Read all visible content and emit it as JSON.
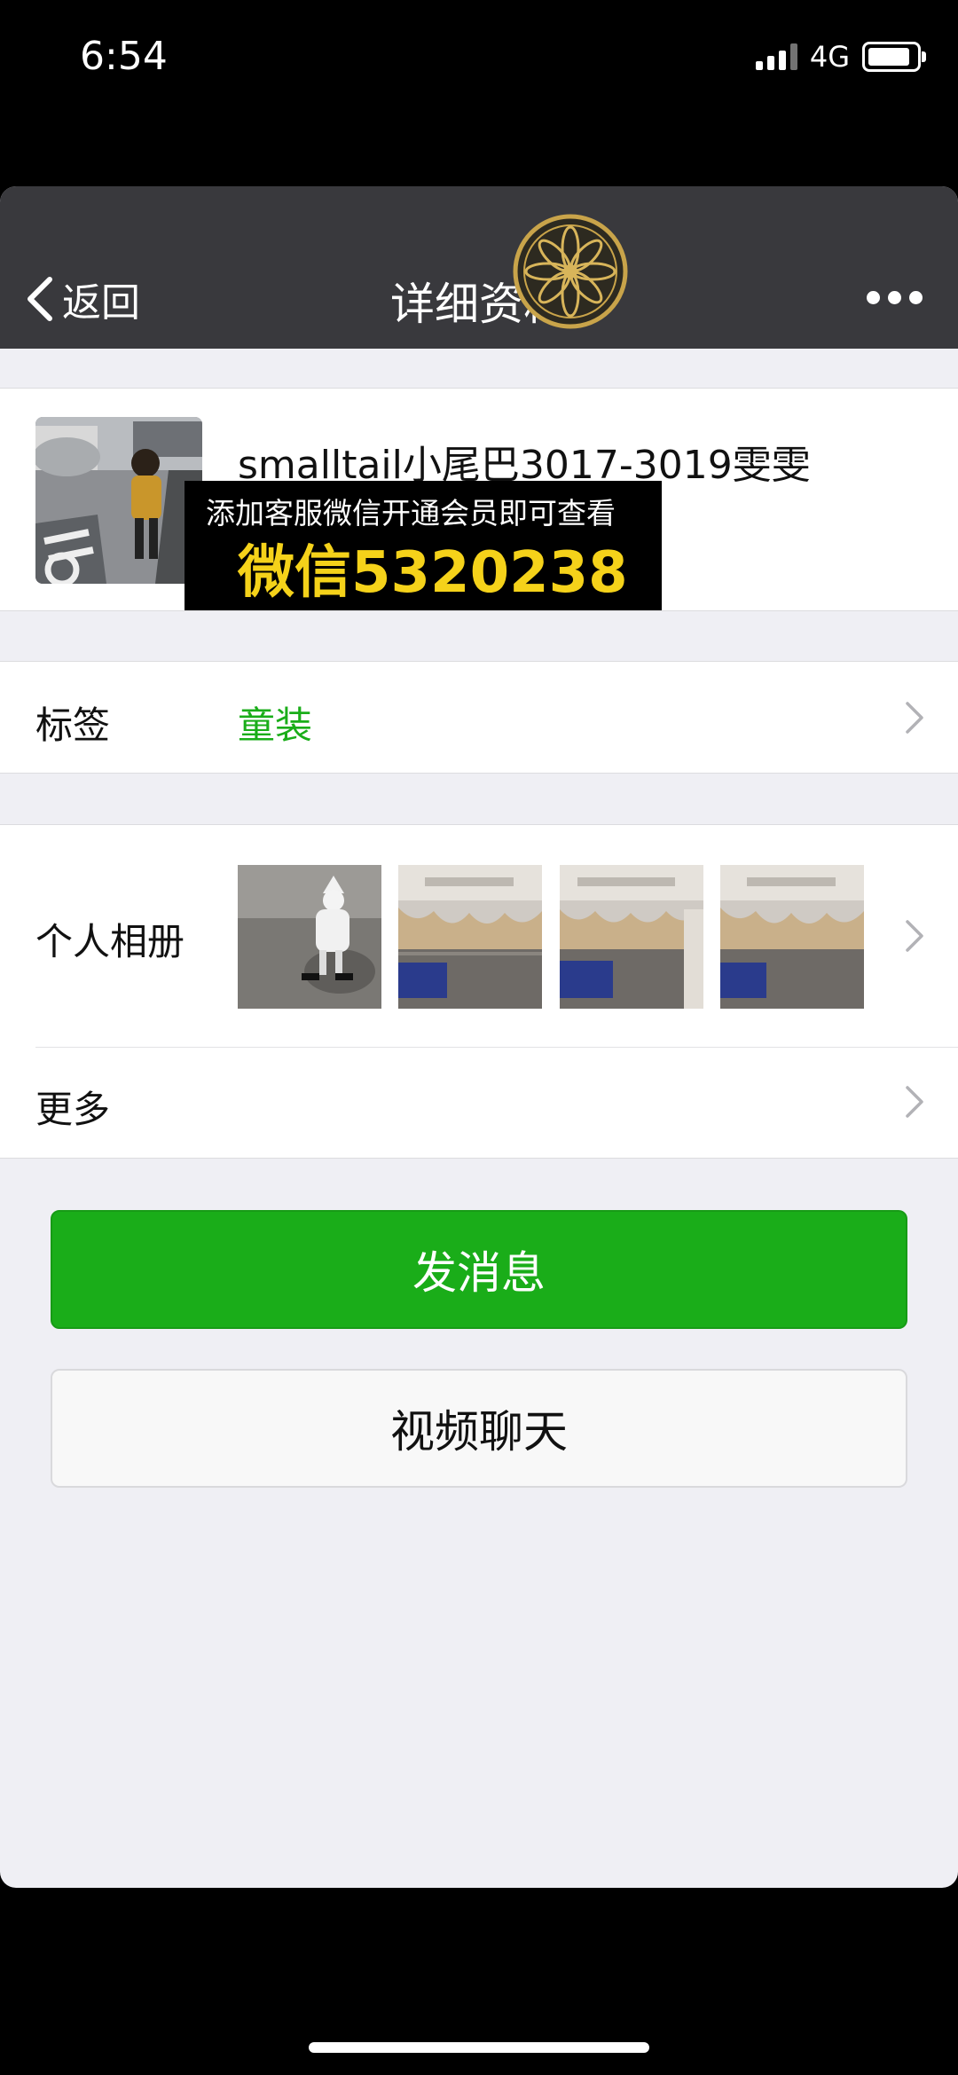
{
  "status_bar": {
    "time": "6:54",
    "network": "4G"
  },
  "nav": {
    "back_label": "返回",
    "title": "详细资料"
  },
  "profile": {
    "name": "smalltail小尾巴3017-3019雯雯",
    "overlay_line1": "添加客服微信开通会员即可查看",
    "overlay_line2": "微信5320238"
  },
  "tags_row": {
    "label": "标签",
    "value": "童装"
  },
  "album_row": {
    "label": "个人相册"
  },
  "more_row": {
    "label": "更多"
  },
  "buttons": {
    "message": "发消息",
    "video_chat": "视频聊天"
  },
  "colors": {
    "accent_green": "#1aad19",
    "nav_bg": "#39393d",
    "overlay_text": "#f5d21a"
  }
}
